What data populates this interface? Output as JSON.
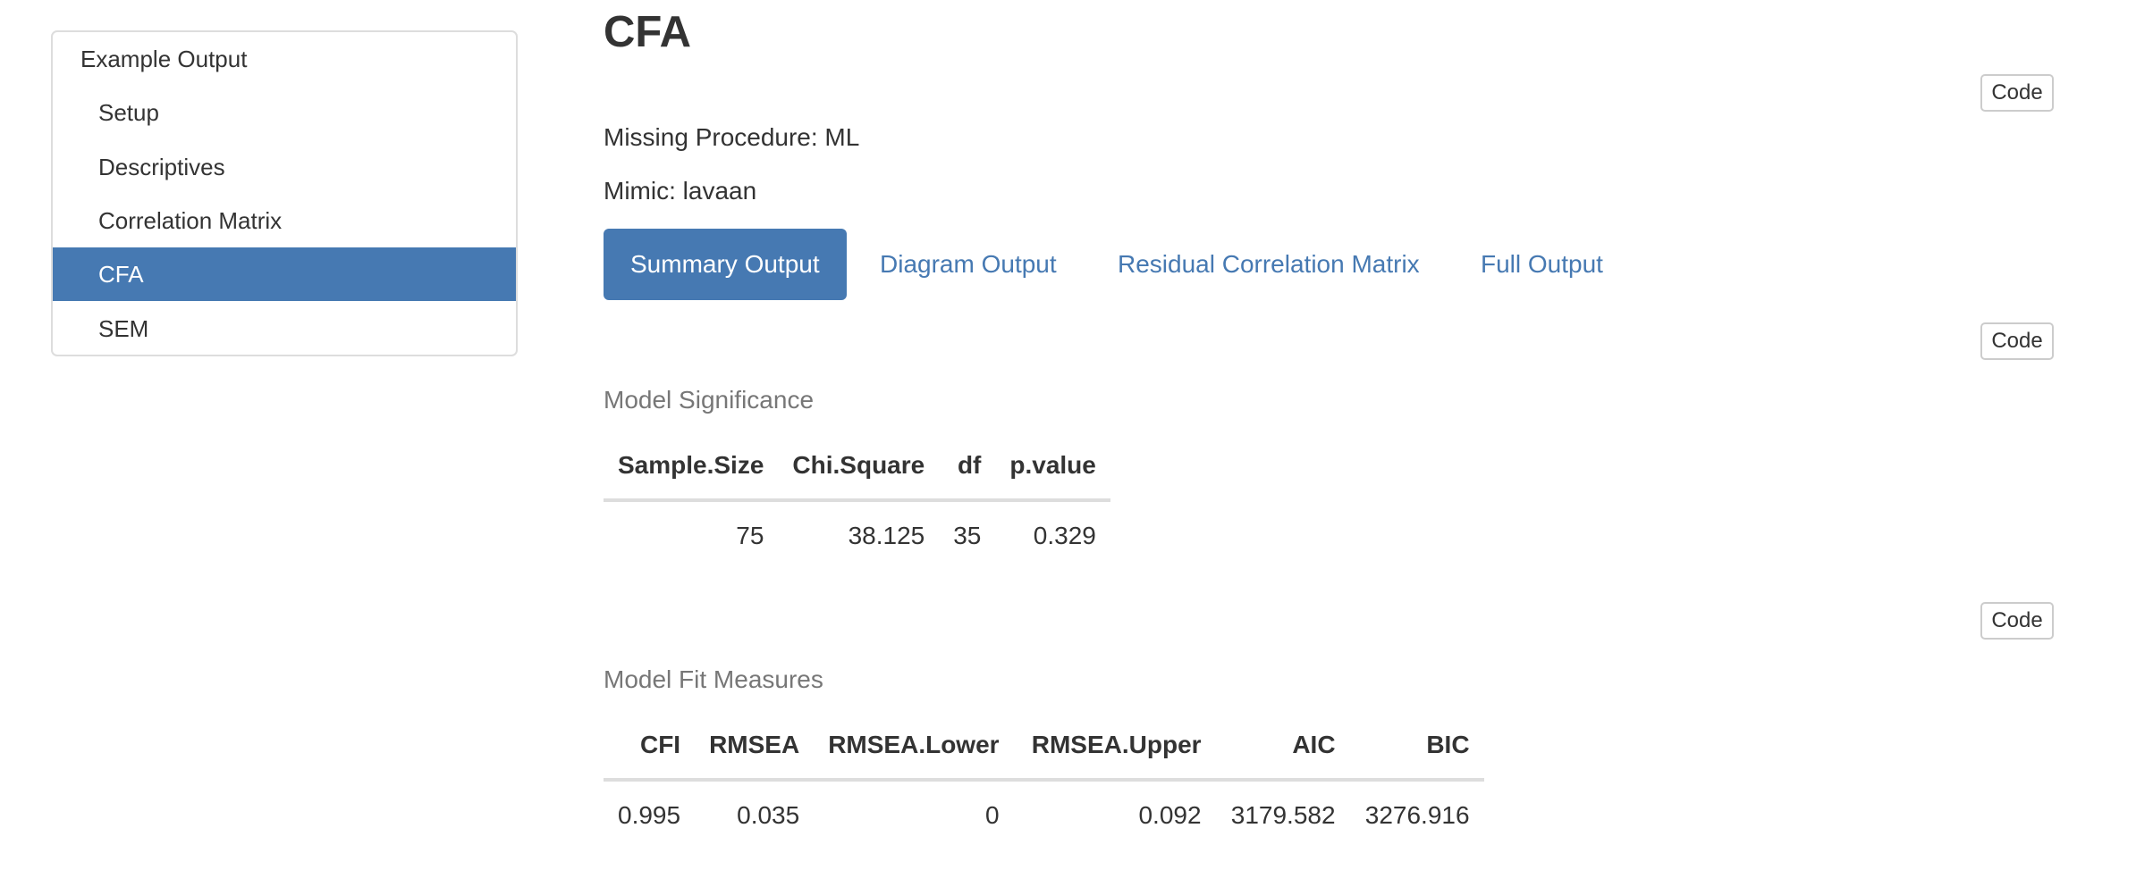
{
  "toc": {
    "items": [
      {
        "label": "Example Output"
      },
      {
        "label": "Setup"
      },
      {
        "label": "Descriptives"
      },
      {
        "label": "Correlation Matrix"
      },
      {
        "label": "CFA"
      },
      {
        "label": "SEM"
      }
    ]
  },
  "main": {
    "title": "CFA",
    "code_label": "Code",
    "missing_procedure": "Missing Procedure: ML",
    "mimic": "Mimic: lavaan",
    "tabs": [
      {
        "label": "Summary Output"
      },
      {
        "label": "Diagram Output"
      },
      {
        "label": "Residual Correlation Matrix"
      },
      {
        "label": "Full Output"
      }
    ]
  },
  "model_significance": {
    "caption": "Model Significance",
    "columns": [
      "Sample.Size",
      "Chi.Square",
      "df",
      "p.value"
    ],
    "rows": [
      [
        "75",
        "38.125",
        "35",
        "0.329"
      ]
    ]
  },
  "model_fit": {
    "caption": "Model Fit Measures",
    "columns": [
      "CFI",
      "RMSEA",
      "RMSEA.Lower",
      "RMSEA.Upper",
      "AIC",
      "BIC"
    ],
    "rows": [
      [
        "0.995",
        "0.035",
        "0",
        "0.092",
        "3179.582",
        "3276.916"
      ]
    ]
  },
  "colors": {
    "accent": "#4679b2",
    "text": "#333333",
    "caption": "#777777",
    "border": "#dddddd"
  }
}
